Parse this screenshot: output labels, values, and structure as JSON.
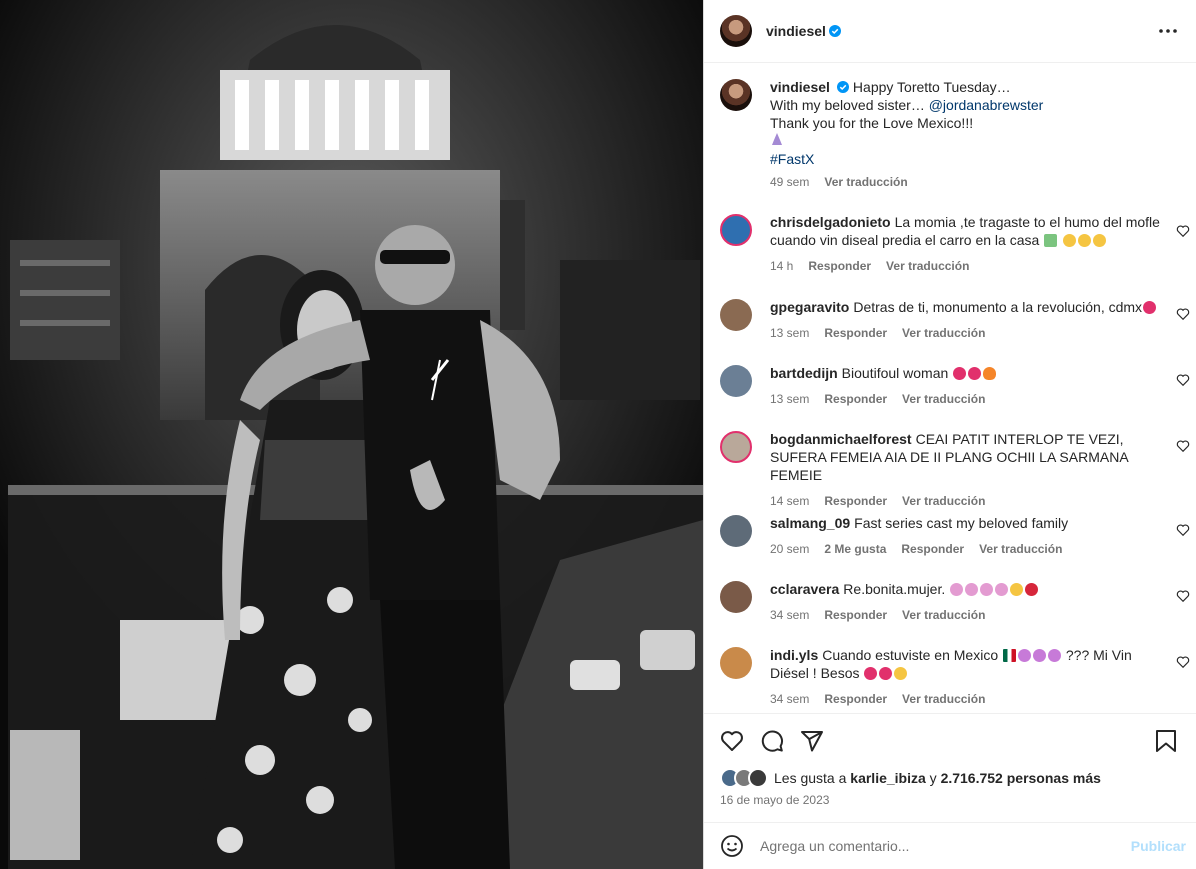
{
  "post": {
    "author": "vindiesel",
    "caption_lines": [
      "Happy Toretto Tuesday…",
      "With my beloved sister… ",
      "Thank you for the Love Mexico!!!",
      "#FastX"
    ],
    "caption_mention": "@jordanabrewster",
    "caption_time": "49 sem",
    "see_translation": "Ver traducción",
    "photo_icon": "black-and-white-photo"
  },
  "comments": [
    {
      "user": "chrisdelgadonieto",
      "text": "La momia ,te tragaste to el humo del mofle cuando vin diseal predia el carro en la casa",
      "time": "14 h",
      "reply": "Responder",
      "translate": "Ver traducción",
      "avatar": "#2f6fb0"
    },
    {
      "user": "gpegaravito",
      "text": "Detras de ti, monumento a la revolución, cdmx",
      "time": "13 sem",
      "reply": "Responder",
      "translate": "Ver traducción",
      "avatar": "#8a6a52"
    },
    {
      "user": "bartdedijn",
      "text": "Bioutifoul woman",
      "time": "13 sem",
      "reply": "Responder",
      "translate": "Ver traducción",
      "avatar": "#6b7f95"
    },
    {
      "user": "bogdanmichaelforest",
      "text": "CEAI PATIT INTERLOP TE VEZI, SUFERA FEMEIA AIA DE II PLANG OCHII LA SARMANA FEMEIE",
      "time": "14 sem",
      "reply": "Responder",
      "translate": "Ver traducción",
      "avatar": "#b9a89a"
    },
    {
      "user": "salmang_09",
      "text": "Fast series cast my beloved family",
      "time": "20 sem",
      "likes": "2 Me gusta",
      "reply": "Responder",
      "translate": "Ver traducción",
      "avatar": "#5e6b78"
    },
    {
      "user": "cclaravera",
      "text": "Re.bonita.mujer.",
      "time": "34 sem",
      "reply": "Responder",
      "translate": "Ver traducción",
      "avatar": "#7a5a48"
    },
    {
      "user": "indi.yls",
      "text": "Cuando estuviste en Mexico",
      "text_tail": "??? Mi Vin Diésel ! Besos",
      "time": "34 sem",
      "reply": "Responder",
      "translate": "Ver traducción",
      "avatar": "#c98a4a"
    }
  ],
  "likes": {
    "prefix": "Les gusta a",
    "user": "karlie_ibiza",
    "joiner": "y",
    "count": "2.716.752 personas más"
  },
  "date": "16 de mayo de 2023",
  "add_comment": {
    "placeholder": "Agrega un comentario...",
    "publish": "Publicar"
  },
  "colors": {
    "verified": "#0095f6",
    "link": "#00376b",
    "muted": "#737373",
    "publish_disabled": "#b2dffc"
  }
}
